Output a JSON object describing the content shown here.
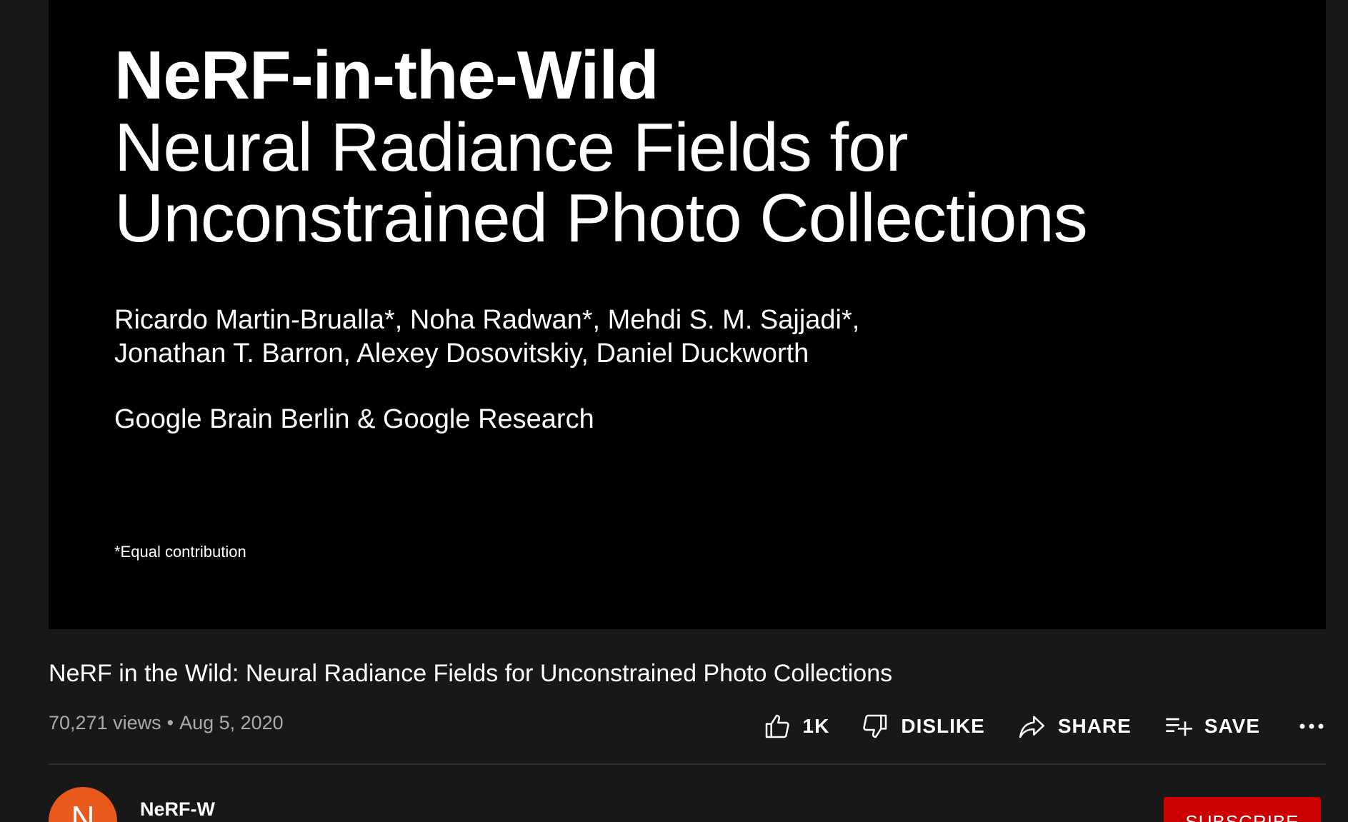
{
  "player": {
    "slide": {
      "title": "NeRF-in-the-Wild",
      "subtitle_lines": [
        "Neural Radiance Fields for",
        "Unconstrained Photo Collections"
      ],
      "author_lines": [
        "Ricardo Martin-Brualla*, Noha Radwan*, Mehdi S. M. Sajjadi*,",
        "Jonathan T. Barron, Alexey Dosovitskiy, Daniel Duckworth"
      ],
      "affiliation": "Google Brain Berlin & Google Research",
      "note": "*Equal contribution"
    }
  },
  "video": {
    "title": "NeRF in the Wild: Neural Radiance Fields for Unconstrained Photo Collections",
    "views": "70,271 views",
    "separator": "•",
    "date": "Aug 5, 2020"
  },
  "actions": {
    "like": {
      "label": "1K",
      "icon": "thumbs-up-icon"
    },
    "dislike": {
      "label": "DISLIKE",
      "icon": "thumbs-down-icon"
    },
    "share": {
      "label": "SHARE",
      "icon": "share-arrow-icon"
    },
    "save": {
      "label": "SAVE",
      "icon": "playlist-add-icon"
    },
    "more": {
      "icon": "more-horizontal-icon"
    }
  },
  "channel": {
    "avatar_letter": "N",
    "avatar_color": "#e8591b",
    "name": "NeRF-W",
    "subscribe_label": "SUBSCRIBE",
    "subscribe_color": "#cc0000"
  }
}
